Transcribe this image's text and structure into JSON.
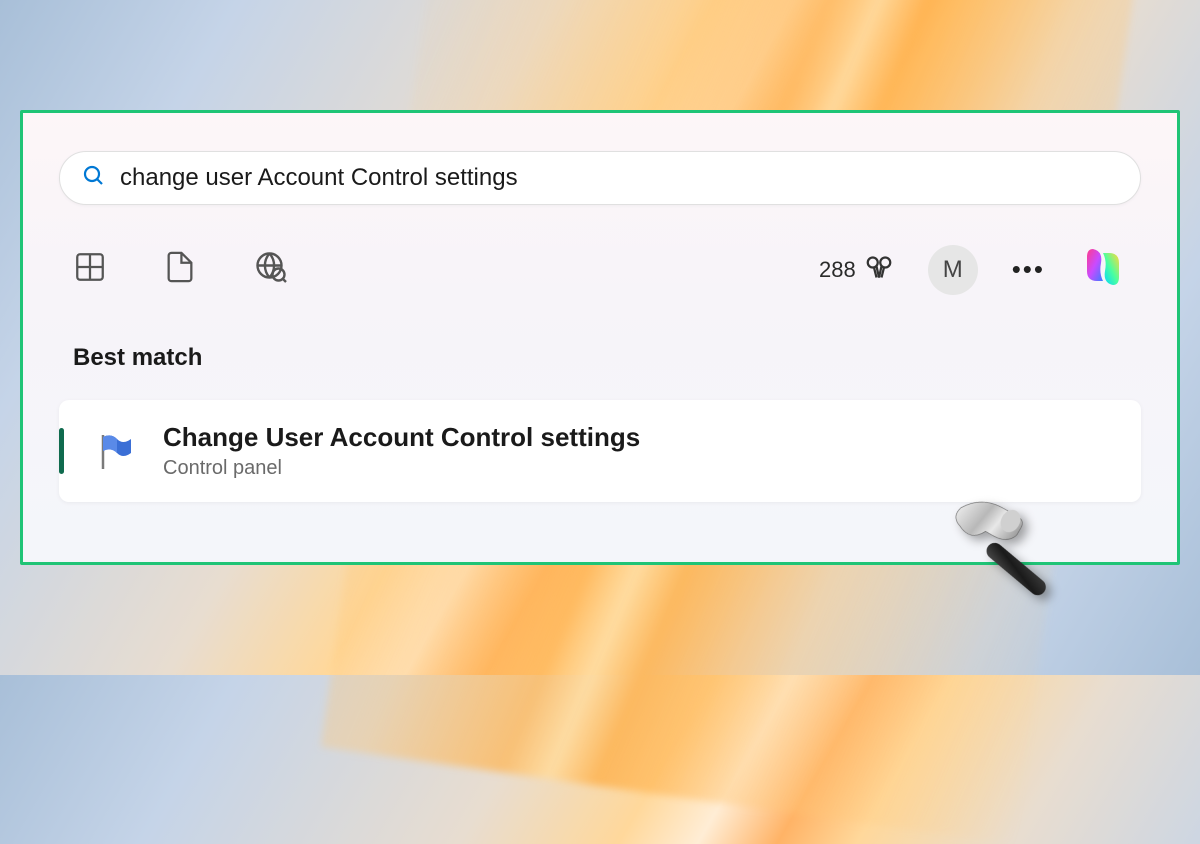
{
  "search": {
    "query": "change user Account Control settings"
  },
  "rewards": {
    "points": "288"
  },
  "avatar": {
    "initial": "M"
  },
  "section": {
    "best_match": "Best match"
  },
  "result": {
    "title": "Change User Account Control settings",
    "subtitle": "Control panel"
  }
}
